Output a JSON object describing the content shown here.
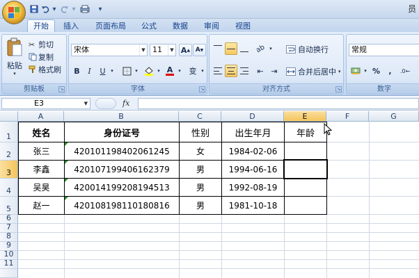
{
  "titlebar": {
    "right_text": "员"
  },
  "ribbon_tabs": [
    {
      "label": "开始",
      "active": true
    },
    {
      "label": "插入"
    },
    {
      "label": "页面布局"
    },
    {
      "label": "公式"
    },
    {
      "label": "数据"
    },
    {
      "label": "审阅"
    },
    {
      "label": "视图"
    }
  ],
  "clipboard": {
    "paste": "粘贴",
    "cut": "剪切",
    "copy": "复制",
    "format_painter": "格式刷",
    "label": "剪贴板"
  },
  "font": {
    "name": "宋体",
    "size": "11",
    "grow": "A",
    "shrink": "A",
    "bold": "B",
    "italic": "I",
    "underline": "U",
    "font_color_glyph": "A",
    "phonetic": "变",
    "label": "字体"
  },
  "alignment": {
    "wrap_text": "自动换行",
    "merge_center": "合并后居中",
    "label": "对齐方式"
  },
  "number": {
    "format": "常规",
    "percent": "%",
    "comma": ",",
    "label": "数字"
  },
  "formula_bar": {
    "cell_ref": "E3",
    "fx": "fx",
    "content": ""
  },
  "columns": [
    "A",
    "B",
    "C",
    "D",
    "E",
    "F",
    "G"
  ],
  "rows": [
    "1",
    "2",
    "3",
    "4",
    "5",
    "6",
    "7",
    "8",
    "9",
    "10",
    "11"
  ],
  "table": {
    "headers": [
      "姓名",
      "身份证号",
      "性别",
      "出生年月",
      "年龄"
    ],
    "records": [
      [
        "张三",
        "420101198402061245",
        "女",
        "1984-02-06",
        ""
      ],
      [
        "李鑫",
        "420107199406162379",
        "男",
        "1994-06-16",
        ""
      ],
      [
        "吴昊",
        "420014199208194513",
        "男",
        "1992-08-19",
        ""
      ],
      [
        "赵一",
        "420108198110180816",
        "男",
        "1981-10-18",
        ""
      ]
    ]
  },
  "selected_cell": "E3",
  "colors": {
    "ribbon_bg": "#d5e3f6",
    "tab_text": "#15428b",
    "selected_header": "#f4c45a",
    "text_flag": "#2d8b2d"
  }
}
